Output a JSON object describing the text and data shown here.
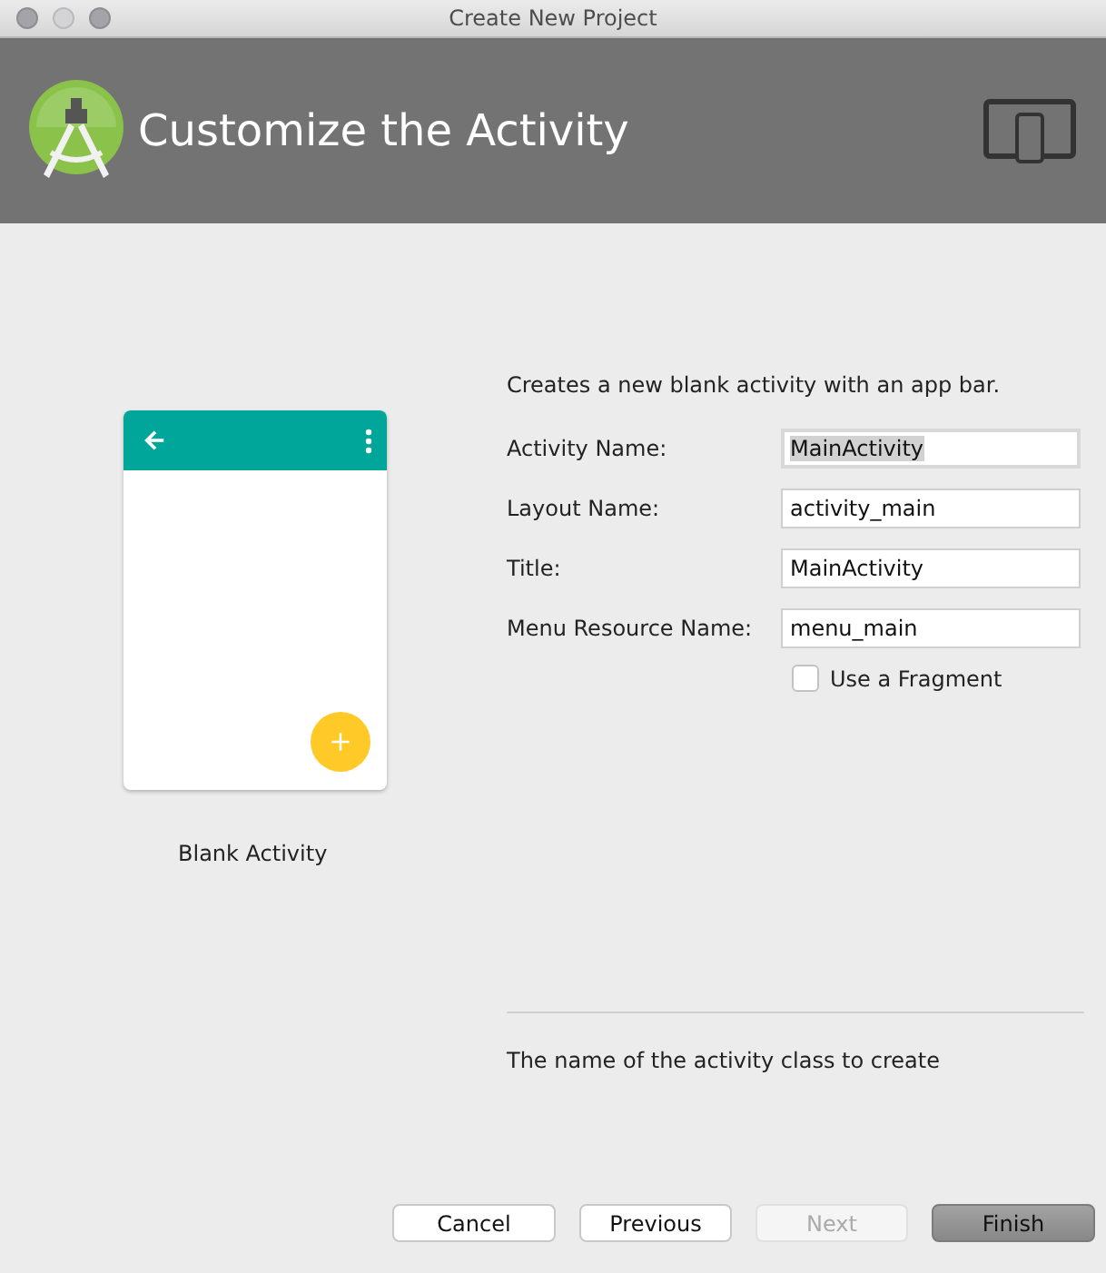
{
  "window": {
    "title": "Create New Project"
  },
  "header": {
    "title": "Customize the Activity"
  },
  "template": {
    "name": "Blank Activity"
  },
  "form": {
    "description": "Creates a new blank activity with an app bar.",
    "fields": [
      {
        "label": "Activity Name:",
        "value": "MainActivity",
        "focused": true
      },
      {
        "label": "Layout Name:",
        "value": "activity_main",
        "focused": false
      },
      {
        "label": "Title:",
        "value": "MainActivity",
        "focused": false
      },
      {
        "label": "Menu Resource Name:",
        "value": "menu_main",
        "focused": false
      }
    ],
    "fragment": {
      "label": "Use a Fragment",
      "checked": false
    },
    "hint": "The name of the activity class to create"
  },
  "buttons": [
    {
      "label": "Cancel",
      "disabled": false,
      "default": false
    },
    {
      "label": "Previous",
      "disabled": false,
      "default": false
    },
    {
      "label": "Next",
      "disabled": true,
      "default": false
    },
    {
      "label": "Finish",
      "disabled": false,
      "default": true
    }
  ]
}
